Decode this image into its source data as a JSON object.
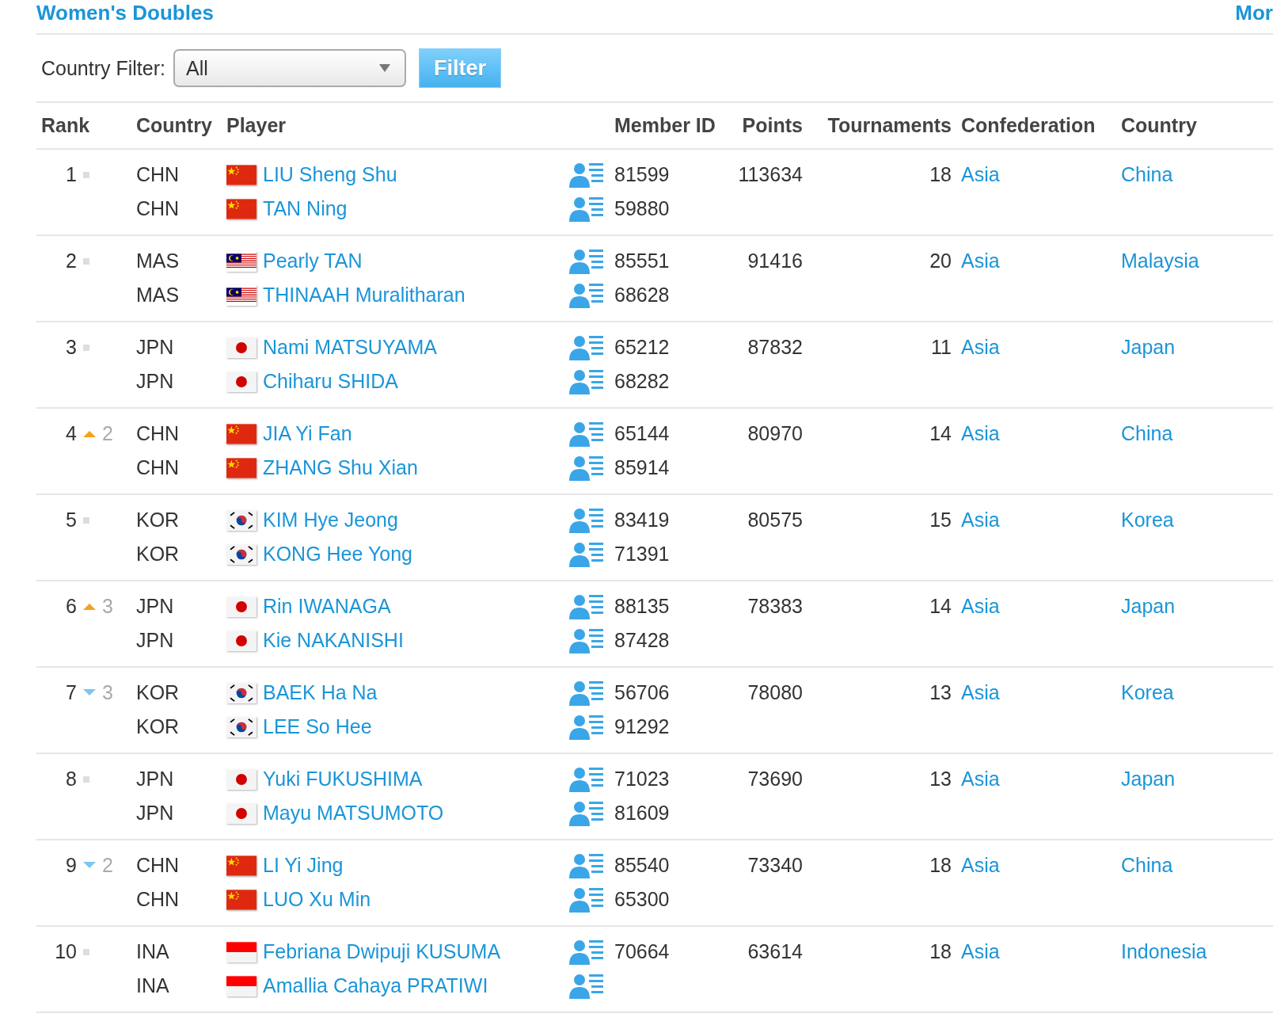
{
  "section_title": "Women's Doubles",
  "more_link": "Mor",
  "filter": {
    "label": "Country Filter:",
    "value": "All",
    "button": "Filter"
  },
  "columns": [
    "Rank",
    "Country",
    "Player",
    "Member ID",
    "Points",
    "Tournaments",
    "Confederation",
    "Country"
  ],
  "rows": [
    {
      "rank": "1",
      "change": {
        "kind": "same"
      },
      "points": "113634",
      "tournaments": "18",
      "confederation": "Asia",
      "country_name": "China",
      "players": [
        {
          "country": "CHN",
          "flag": {
            "kind": "china"
          },
          "name": "LIU Sheng Shu",
          "member_id": "81599"
        },
        {
          "country": "CHN",
          "flag": {
            "kind": "china"
          },
          "name": "TAN Ning",
          "member_id": "59880"
        }
      ]
    },
    {
      "rank": "2",
      "change": {
        "kind": "same"
      },
      "points": "91416",
      "tournaments": "20",
      "confederation": "Asia",
      "country_name": "Malaysia",
      "players": [
        {
          "country": "MAS",
          "flag": {
            "kind": "malaysia"
          },
          "name": "Pearly TAN",
          "member_id": "85551"
        },
        {
          "country": "MAS",
          "flag": {
            "kind": "malaysia"
          },
          "name": "THINAAH Muralitharan",
          "member_id": "68628"
        }
      ]
    },
    {
      "rank": "3",
      "change": {
        "kind": "same"
      },
      "points": "87832",
      "tournaments": "11",
      "confederation": "Asia",
      "country_name": "Japan",
      "players": [
        {
          "country": "JPN",
          "flag": {
            "kind": "japan"
          },
          "name": "Nami MATSUYAMA",
          "member_id": "65212"
        },
        {
          "country": "JPN",
          "flag": {
            "kind": "japan"
          },
          "name": "Chiharu SHIDA",
          "member_id": "68282"
        }
      ]
    },
    {
      "rank": "4",
      "change": {
        "kind": "up",
        "amount": "2"
      },
      "points": "80970",
      "tournaments": "14",
      "confederation": "Asia",
      "country_name": "China",
      "players": [
        {
          "country": "CHN",
          "flag": {
            "kind": "china"
          },
          "name": "JIA Yi Fan",
          "member_id": "65144"
        },
        {
          "country": "CHN",
          "flag": {
            "kind": "china"
          },
          "name": "ZHANG Shu Xian",
          "member_id": "85914"
        }
      ]
    },
    {
      "rank": "5",
      "change": {
        "kind": "same"
      },
      "points": "80575",
      "tournaments": "15",
      "confederation": "Asia",
      "country_name": "Korea",
      "players": [
        {
          "country": "KOR",
          "flag": {
            "kind": "korea"
          },
          "name": "KIM Hye Jeong",
          "member_id": "83419"
        },
        {
          "country": "KOR",
          "flag": {
            "kind": "korea"
          },
          "name": "KONG Hee Yong",
          "member_id": "71391"
        }
      ]
    },
    {
      "rank": "6",
      "change": {
        "kind": "up",
        "amount": "3"
      },
      "points": "78383",
      "tournaments": "14",
      "confederation": "Asia",
      "country_name": "Japan",
      "players": [
        {
          "country": "JPN",
          "flag": {
            "kind": "japan"
          },
          "name": "Rin IWANAGA",
          "member_id": "88135"
        },
        {
          "country": "JPN",
          "flag": {
            "kind": "japan"
          },
          "name": "Kie NAKANISHI",
          "member_id": "87428"
        }
      ]
    },
    {
      "rank": "7",
      "change": {
        "kind": "down",
        "amount": "3"
      },
      "points": "78080",
      "tournaments": "13",
      "confederation": "Asia",
      "country_name": "Korea",
      "players": [
        {
          "country": "KOR",
          "flag": {
            "kind": "korea"
          },
          "name": "BAEK Ha Na",
          "member_id": "56706"
        },
        {
          "country": "KOR",
          "flag": {
            "kind": "korea"
          },
          "name": "LEE So Hee",
          "member_id": "91292"
        }
      ]
    },
    {
      "rank": "8",
      "change": {
        "kind": "same"
      },
      "points": "73690",
      "tournaments": "13",
      "confederation": "Asia",
      "country_name": "Japan",
      "players": [
        {
          "country": "JPN",
          "flag": {
            "kind": "japan"
          },
          "name": "Yuki FUKUSHIMA",
          "member_id": "71023"
        },
        {
          "country": "JPN",
          "flag": {
            "kind": "japan"
          },
          "name": "Mayu MATSUMOTO",
          "member_id": "81609"
        }
      ]
    },
    {
      "rank": "9",
      "change": {
        "kind": "down",
        "amount": "2"
      },
      "points": "73340",
      "tournaments": "18",
      "confederation": "Asia",
      "country_name": "China",
      "players": [
        {
          "country": "CHN",
          "flag": {
            "kind": "china"
          },
          "name": "LI Yi Jing",
          "member_id": "85540"
        },
        {
          "country": "CHN",
          "flag": {
            "kind": "china"
          },
          "name": "LUO Xu Min",
          "member_id": "65300"
        }
      ]
    },
    {
      "rank": "10",
      "change": {
        "kind": "same"
      },
      "points": "63614",
      "tournaments": "18",
      "confederation": "Asia",
      "country_name": "Indonesia",
      "players": [
        {
          "country": "INA",
          "flag": {
            "kind": "indonesia"
          },
          "name": "Febriana Dwipuji KUSUMA",
          "member_id": "70664"
        },
        {
          "country": "INA",
          "flag": {
            "kind": "indonesia"
          },
          "name": "Amallia Cahaya PRATIWI"
        }
      ]
    }
  ]
}
